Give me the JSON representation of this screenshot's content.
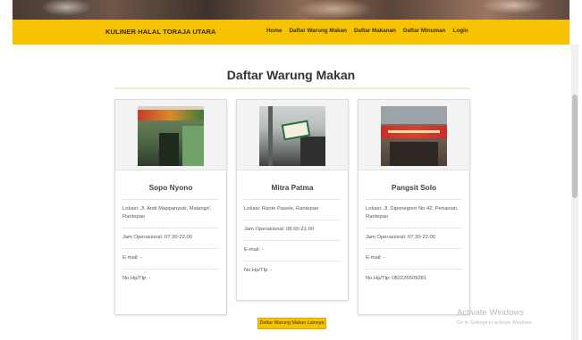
{
  "navbar": {
    "brand": "KULINER HALAL TORAJA UTARA",
    "links": [
      "Home",
      "Daftar Warung Makan",
      "Daftar Makanan",
      "Daftar Minuman",
      "Login"
    ]
  },
  "page": {
    "title": "Daftar Warung Makan"
  },
  "cards": [
    {
      "name": "Sopo Nyono",
      "lokasi": "Lokasi: Jl. Andi Mappanyuki, Malango', Rantepao",
      "jam": "Jam Operasional: 07.30-22.00",
      "email": "E-mail: -",
      "hp": "No.Hp/Tlp: -"
    },
    {
      "name": "Mitra Patma",
      "lokasi": "Lokasi: Rante Pasele, Rantepao",
      "jam": "Jam Operasional: 08.00-21.00",
      "email": "E-mail: -",
      "hp": "No.Hp/Tlp: -"
    },
    {
      "name": "Pangsit Solo",
      "lokasi": "Lokasi: Jl. Diponegoro No.42, Penanian, Rantepao",
      "jam": "Jam Operasional: 07.30-22.00",
      "email": "E-mail: -",
      "hp": "No.Hp/Tlp: 082226509281"
    }
  ],
  "more_button": "Daftar Warung Makan Lainnya",
  "watermark": {
    "title": "Activate Windows",
    "subtitle": "Go to Settings to activate Windows."
  },
  "colors": {
    "navbar": "#f7c300",
    "button": "#f7c300"
  }
}
